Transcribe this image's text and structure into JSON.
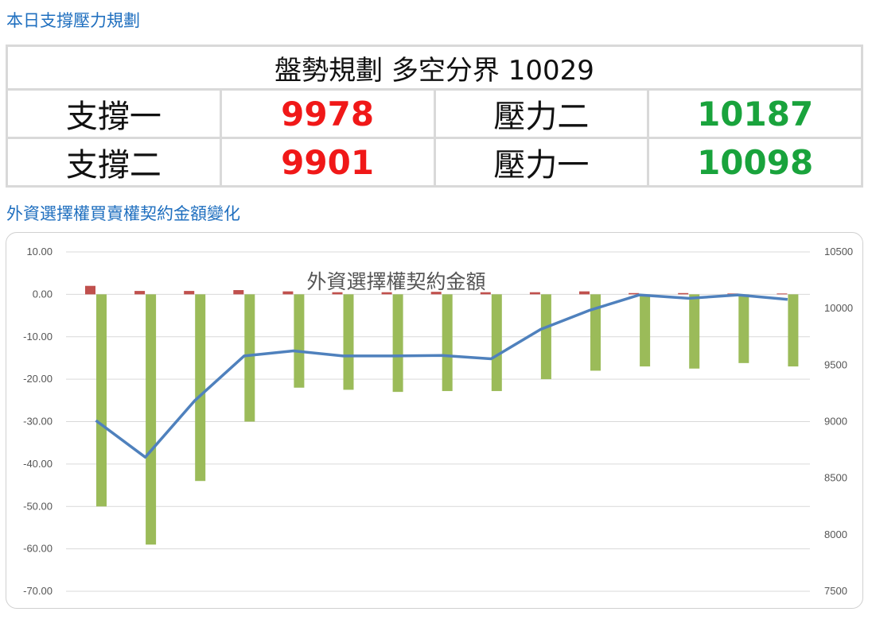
{
  "header": {
    "title": "本日支撐壓力規劃"
  },
  "plan": {
    "heading": "盤勢規劃 多空分界 10029",
    "rows": [
      {
        "left_label": "支撐一",
        "left_value": "9978",
        "right_label": "壓力二",
        "right_value": "10187"
      },
      {
        "left_label": "支撐二",
        "left_value": "9901",
        "right_label": "壓力一",
        "right_value": "10098"
      }
    ],
    "colors": {
      "support": "#f01818",
      "pressure": "#19a33c"
    }
  },
  "section2": {
    "title": "外資選擇權買賣權契約金額變化"
  },
  "chart_data": {
    "type": "bar",
    "title": "外資選擇權契約金額",
    "categories": [
      "",
      "",
      "",
      "",
      "",
      "",
      "",
      "",
      "",
      "",
      "",
      "",
      "",
      "",
      ""
    ],
    "series": [
      {
        "axis": "left",
        "type": "bar",
        "color": "#c0504d",
        "values": [
          2.0,
          0.8,
          0.8,
          1.0,
          0.7,
          0.5,
          0.5,
          0.6,
          0.5,
          0.5,
          0.7,
          0.3,
          0.3,
          0.2,
          0.2
        ]
      },
      {
        "axis": "left",
        "type": "bar",
        "color": "#9bbb59",
        "values": [
          -50.0,
          -59.0,
          -44.0,
          -30.0,
          -22.0,
          -22.5,
          -23.0,
          -22.8,
          -22.8,
          -20.0,
          -18.0,
          -17.0,
          -17.5,
          -16.2,
          -17.0
        ]
      },
      {
        "axis": "right",
        "type": "line",
        "color": "#4f81bd",
        "values": [
          9010,
          8685,
          9185,
          9580,
          9625,
          9580,
          9580,
          9585,
          9555,
          9815,
          9985,
          10120,
          10090,
          10120,
          10080
        ]
      }
    ],
    "ylim": [
      -70,
      10
    ],
    "yticks": [
      "10.00",
      "0.00",
      "-10.00",
      "-20.00",
      "-30.00",
      "-40.00",
      "-50.00",
      "-60.00",
      "-70.00"
    ],
    "y2lim": [
      7500,
      10500
    ],
    "y2ticks": [
      "10500",
      "10000",
      "9500",
      "9000",
      "8500",
      "8000",
      "7500"
    ],
    "grid": true
  }
}
